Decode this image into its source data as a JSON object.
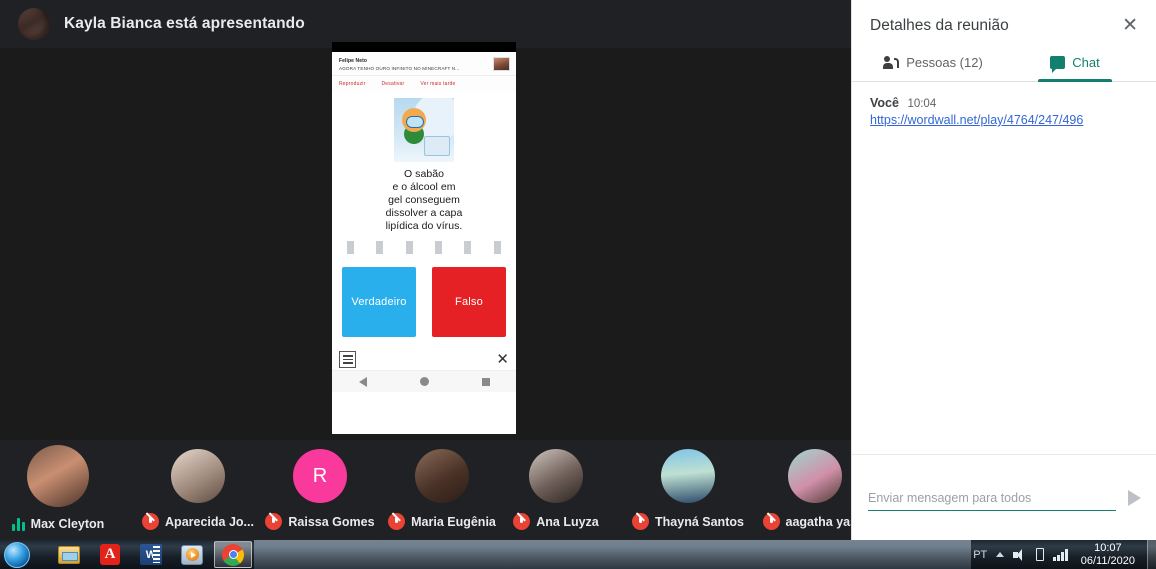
{
  "presentation": {
    "presenter_banner": "Kayla Bianca está apresentando",
    "presenter_avatar_name": "presenter-avatar"
  },
  "shared_screen": {
    "notification": {
      "channel": "Felipe Neto",
      "headline": "AGORA TENHO OURO INFINITO NO MINECRAFT N...",
      "actions": [
        "Reproduzir",
        "Desativar",
        "Ver mais tarde"
      ]
    },
    "quiz": {
      "question": "O sabão\ne o álcool em\ngel conseguem\ndissolver a capa\nlipídica do vírus.",
      "answers": [
        {
          "label": "Verdadeiro",
          "color": "#29b0ec"
        },
        {
          "label": "Falso",
          "color": "#e62126"
        }
      ]
    },
    "nav_buttons": [
      "back-triangle",
      "home-circle",
      "recents-square"
    ]
  },
  "participants": [
    {
      "name": "Max Cleyton",
      "muted": false,
      "speaking": true,
      "initial": "",
      "avatar_type": "photo"
    },
    {
      "name": "Aparecida Jo...",
      "muted": true,
      "speaking": false,
      "initial": "",
      "avatar_type": "photo"
    },
    {
      "name": "Raissa Gomes",
      "muted": true,
      "speaking": false,
      "initial": "R",
      "avatar_type": "initial"
    },
    {
      "name": "Maria Eugênia",
      "muted": true,
      "speaking": false,
      "initial": "",
      "avatar_type": "photo"
    },
    {
      "name": "Ana Luyza",
      "muted": true,
      "speaking": false,
      "initial": "",
      "avatar_type": "photo"
    },
    {
      "name": "Thayná Santos",
      "muted": true,
      "speaking": false,
      "initial": "",
      "avatar_type": "photo"
    },
    {
      "name": "aagatha yas...",
      "muted": true,
      "speaking": false,
      "initial": "",
      "avatar_type": "photo"
    }
  ],
  "panel": {
    "title": "Detalhes da reunião",
    "close_label": "✕",
    "tabs": [
      {
        "label": "Pessoas (12)",
        "active": false,
        "icon": "people-icon"
      },
      {
        "label": "Chat",
        "active": true,
        "icon": "chat-icon"
      }
    ],
    "messages": [
      {
        "author": "Você",
        "time": "10:04",
        "link": "https://wordwall.net/play/4764/247/496"
      }
    ],
    "composer": {
      "placeholder": "Enviar mensagem para todos",
      "value": "",
      "send_icon": "send-icon"
    },
    "accent_color": "#13806e"
  },
  "taskbar": {
    "start_label": "start-orb",
    "apps": [
      {
        "name": "file-explorer",
        "active": false
      },
      {
        "name": "adobe-acrobat",
        "active": false,
        "glyph": "Å"
      },
      {
        "name": "microsoft-word",
        "active": false,
        "glyph": "W"
      },
      {
        "name": "windows-media-player",
        "active": false
      },
      {
        "name": "google-chrome",
        "active": true
      }
    ],
    "tray": {
      "language": "PT",
      "time": "10:07",
      "date": "06/11/2020"
    }
  }
}
